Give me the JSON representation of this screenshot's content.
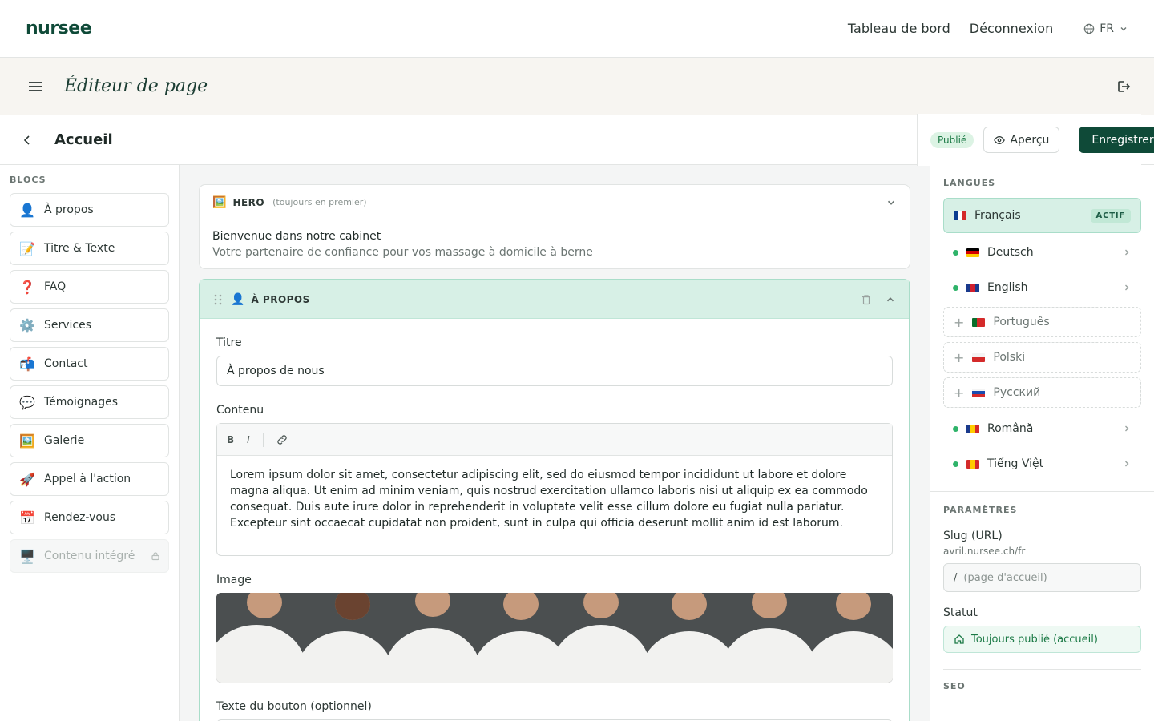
{
  "topnav": {
    "logo": "nursee",
    "dashboard": "Tableau de bord",
    "logout": "Déconnexion",
    "lang": "FR"
  },
  "editorbar": {
    "title": "Éditeur de page"
  },
  "pagebar": {
    "title": "Accueil",
    "status": "Publié",
    "preview": "Aperçu",
    "save": "Enregistrer"
  },
  "left": {
    "label": "BLOCS",
    "items": [
      {
        "emoji": "👤",
        "label": "À propos"
      },
      {
        "emoji": "📝",
        "label": "Titre & Texte"
      },
      {
        "emoji": "❓",
        "label": "FAQ"
      },
      {
        "emoji": "⚙️",
        "label": "Services"
      },
      {
        "emoji": "📬",
        "label": "Contact"
      },
      {
        "emoji": "💬",
        "label": "Témoignages"
      },
      {
        "emoji": "🖼️",
        "label": "Galerie"
      },
      {
        "emoji": "🚀",
        "label": "Appel à l'action"
      },
      {
        "emoji": "📅",
        "label": "Rendez-vous"
      },
      {
        "emoji": "🖥️",
        "label": "Contenu intégré"
      }
    ]
  },
  "hero": {
    "emoji": "🖼️",
    "kind": "HERO",
    "hint": "(toujours en premier)",
    "heading": "Bienvenue dans notre cabinet",
    "subtitle": "Votre partenaire de confiance pour vos massage à domicile à berne"
  },
  "about": {
    "emoji": "👤",
    "kind": "À PROPOS",
    "title_label": "Titre",
    "title_value": "À propos de nous",
    "content_label": "Contenu",
    "content_value": "Lorem ipsum dolor sit amet, consectetur adipiscing elit, sed do eiusmod tempor incididunt ut labore et dolore magna aliqua. Ut enim ad minim veniam, quis nostrud exercitation ullamco laboris nisi ut aliquip ex ea commodo consequat. Duis aute irure dolor in reprehenderit in voluptate velit esse cillum dolore eu fugiat nulla pariatur. Excepteur sint occaecat cupidatat non proident, sunt in culpa qui officia deserunt mollit anim id est laborum.",
    "toolbar": {
      "bold": "B",
      "italic": "I"
    },
    "image_label": "Image",
    "button_label": "Texte du bouton (optionnel)"
  },
  "right": {
    "lang_label": "LANGUES",
    "active_badge": "ACTIF",
    "languages": [
      {
        "name": "Français",
        "state": "active",
        "flag": [
          "#0a3d91",
          "#ffffff",
          "#d42a2a"
        ]
      },
      {
        "name": "Deutsch",
        "state": "done",
        "flag": [
          "#000000",
          "#d40000",
          "#ffcc00"
        ]
      },
      {
        "name": "English",
        "state": "done",
        "flag": [
          "#1a3a8c",
          "#cf1f2e",
          "#1a3a8c"
        ]
      },
      {
        "name": "Português",
        "state": "add",
        "flag": [
          "#0a6e2b",
          "#d42a2a",
          "#d42a2a"
        ]
      },
      {
        "name": "Polski",
        "state": "add",
        "flag": [
          "#ffffff",
          "#d42a2a",
          "#d42a2a"
        ]
      },
      {
        "name": "Русский",
        "state": "add",
        "flag": [
          "#ffffff",
          "#1a4cb0",
          "#d42a2a"
        ]
      },
      {
        "name": "Română",
        "state": "done",
        "flag": [
          "#1a3a8c",
          "#ffcc00",
          "#d42a2a"
        ]
      },
      {
        "name": "Tiếng Việt",
        "state": "done",
        "flag": [
          "#d42a2a",
          "#ffcc00",
          "#d42a2a"
        ]
      }
    ],
    "params_label": "PARAMÈTRES",
    "slug_label": "Slug (URL)",
    "slug_domain": "avril.nursee.ch/fr",
    "slug_prefix": "/",
    "slug_placeholder": "(page d'accueil)",
    "status_label": "Statut",
    "status_value": "Toujours publié (accueil)",
    "seo_label": "SEO"
  },
  "colors": {
    "brand": "#0f4a38",
    "accent": "#d7f0e6"
  }
}
